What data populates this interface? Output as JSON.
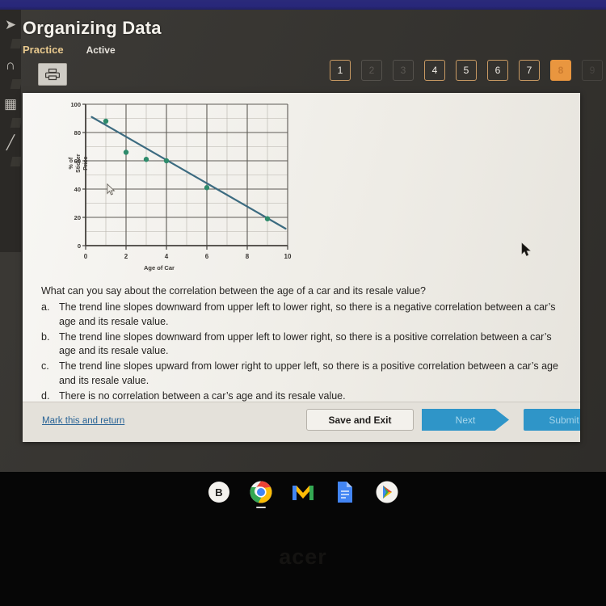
{
  "header": {
    "title": "Organizing Data",
    "assignment_type": "Practice",
    "assignment_state": "Active",
    "print_icon": "printer-icon"
  },
  "pager": {
    "items": [
      {
        "label": "1",
        "state": "available"
      },
      {
        "label": "2",
        "state": "disabled"
      },
      {
        "label": "3",
        "state": "disabled"
      },
      {
        "label": "4",
        "state": "available"
      },
      {
        "label": "5",
        "state": "available"
      },
      {
        "label": "6",
        "state": "available"
      },
      {
        "label": "7",
        "state": "available"
      },
      {
        "label": "8",
        "state": "current"
      },
      {
        "label": "9",
        "state": "edge"
      }
    ],
    "accent_color": "#e9963f",
    "border_color": "#c99a63"
  },
  "left_rail": {
    "icons": [
      "chevron-right-icon",
      "magnet-icon",
      "calculator-icon",
      "line-tool-icon"
    ]
  },
  "chart_data": {
    "type": "scatter",
    "title": "",
    "xlabel": "Age of Car",
    "ylabel": "% of Sticker Price",
    "ylabel_lines": [
      "% of",
      "Sticker",
      "Price"
    ],
    "xlim": [
      0,
      10
    ],
    "ylim": [
      0,
      100
    ],
    "xticks": [
      0,
      2,
      4,
      6,
      8,
      10
    ],
    "yticks": [
      0,
      20,
      40,
      60,
      80,
      100
    ],
    "grid": true,
    "minor_grid": true,
    "legend": "none",
    "point_color": "#2e8b6b",
    "line_color": "#3c6b80",
    "points": [
      {
        "x": 1,
        "y": 88
      },
      {
        "x": 2,
        "y": 66
      },
      {
        "x": 3,
        "y": 61
      },
      {
        "x": 4,
        "y": 60
      },
      {
        "x": 6,
        "y": 41
      },
      {
        "x": 9,
        "y": 19
      }
    ],
    "series": [
      {
        "name": "trend line",
        "type": "line",
        "points": [
          {
            "x": 0.3,
            "y": 91
          },
          {
            "x": 9.9,
            "y": 12
          }
        ]
      }
    ]
  },
  "question": {
    "stem": "What can you say about the correlation between the age of a car and its resale value?",
    "options": [
      {
        "letter": "a.",
        "text": "The trend line slopes downward from upper left to lower right, so there is a negative correlation between a car’s age and its resale value."
      },
      {
        "letter": "b.",
        "text": "The trend line slopes downward from upper left to lower right, so there is a positive correlation between a car’s age and its resale value."
      },
      {
        "letter": "c.",
        "text": "The trend line slopes upward from lower right to upper left, so there is a positive correlation between a car’s age and its resale value."
      },
      {
        "letter": "d.",
        "text": "There is no correlation between a car’s age and its resale value."
      }
    ]
  },
  "footer": {
    "mark_return_label": "Mark this and return",
    "save_exit_label": "Save and Exit",
    "next_label": "Next",
    "submit_label": "Submit",
    "button_color": "#2f95c8",
    "link_color": "#2a6496"
  },
  "shelf": {
    "launcher_label": "B",
    "icons": [
      "launcher-icon",
      "chrome-icon",
      "gmail-icon",
      "google-docs-icon",
      "play-store-icon"
    ]
  },
  "device": {
    "brand": "acer"
  }
}
